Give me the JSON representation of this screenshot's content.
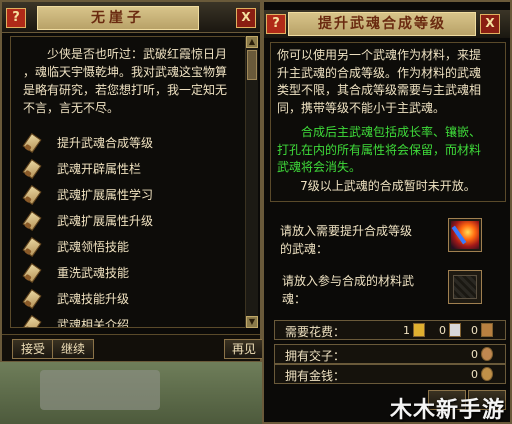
{
  "left_window": {
    "help_label": "?",
    "close_label": "X",
    "title": "无崖子",
    "intro_lines": [
      "少侠是否也听过：武破红霞惊日月",
      "，魂临天宇慑乾坤。我对武魂这宝物算",
      "是略有研究，若您想打听，我一定知无",
      "不言，言无不尽。"
    ],
    "menu_items": [
      "提升武魂合成等级",
      "武魂开辟属性栏",
      "武魂扩展属性学习",
      "武魂扩展属性升级",
      "武魂领悟技能",
      "重洗武魂技能",
      "武魂技能升级",
      "武魂相关介绍"
    ],
    "buttons": {
      "accept": "接受",
      "continue": "继续",
      "goodbye": "再见"
    }
  },
  "right_window": {
    "help_label": "?",
    "close_label": "X",
    "title": "提升武魂合成等级",
    "description_lines": [
      "你可以使用另一个武魂作为材料，来提",
      "升主武魂的合成等级。作为材料的武魂",
      "类型不限，其合成等级需要与主武魂相",
      "同，携带等级不能小于主武魂。"
    ],
    "green_lines": [
      "合成后主武魂包括成长率、镶嵌、",
      "打孔在内的所有属性将会保留，而材料",
      "武魂将会消失。"
    ],
    "note": "7级以上武魂的合成暂时未开放。",
    "slot1_label_lines": [
      "请放入需要提升合成等级",
      "的武魂："
    ],
    "slot2_label_lines": [
      "请放入参与合成的材料武",
      "魂："
    ],
    "cost": {
      "label": "需要花费：",
      "gold": "1",
      "silver": "0",
      "copper": "0"
    },
    "jiaozi": {
      "label": "拥有交子：",
      "value": "0"
    },
    "money": {
      "label": "拥有金钱：",
      "value": "0"
    },
    "colors": {
      "green_text": "#3fdc3a",
      "title_bg": "#d0bb80"
    }
  },
  "watermark": "木木新手游"
}
